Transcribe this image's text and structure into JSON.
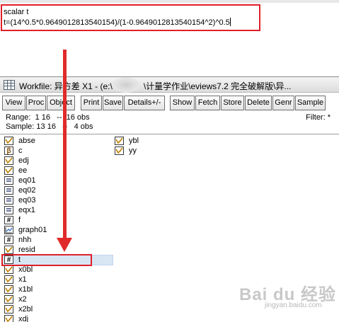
{
  "command": {
    "line1": "scalar t",
    "line2": "t=(14^0.5*0.9649012813540154)/(1-0.9649012813540154^2)^0.5"
  },
  "workfile": {
    "title": "Workfile: 异方差 X1 - (e:\\",
    "title_path": "\\计量学作业\\eviews7.2 完全破解版\\异...",
    "window_buttons": [
      "-",
      "□",
      "×"
    ],
    "toolbar": [
      "View",
      "Proc",
      "Object",
      "Print",
      "Save",
      "Details+/-",
      "Show",
      "Fetch",
      "Store",
      "Delete",
      "Genr",
      "Sample"
    ],
    "range_line": "Range:  1 16   --  16 obs",
    "sample_line": "Sample: 13 16   --   4 obs",
    "filter": "Filter: *"
  },
  "objects_col1": [
    {
      "name": "abse",
      "icon": "series-icon"
    },
    {
      "name": "c",
      "icon": "coef-icon"
    },
    {
      "name": "edj",
      "icon": "series-icon"
    },
    {
      "name": "ee",
      "icon": "series-icon"
    },
    {
      "name": "eq01",
      "icon": "equation-icon"
    },
    {
      "name": "eq02",
      "icon": "equation-icon"
    },
    {
      "name": "eq03",
      "icon": "equation-icon"
    },
    {
      "name": "eqx1",
      "icon": "equation-icon"
    },
    {
      "name": "f",
      "icon": "scalar-icon"
    },
    {
      "name": "graph01",
      "icon": "graph-icon"
    },
    {
      "name": "nhh",
      "icon": "scalar-icon"
    },
    {
      "name": "resid",
      "icon": "series-icon"
    },
    {
      "name": "t",
      "icon": "scalar-icon"
    },
    {
      "name": "x0bl",
      "icon": "series-icon"
    },
    {
      "name": "x1",
      "icon": "series-icon"
    },
    {
      "name": "x1bl",
      "icon": "series-icon"
    },
    {
      "name": "x2",
      "icon": "series-icon"
    },
    {
      "name": "x2bl",
      "icon": "series-icon"
    },
    {
      "name": "xdj",
      "icon": "series-icon"
    }
  ],
  "objects_col2": [
    {
      "name": "ybl",
      "icon": "series-icon"
    },
    {
      "name": "yy",
      "icon": "series-icon"
    }
  ],
  "watermark": {
    "big": "Bai du 经验",
    "small": "jingyan.baidu.com"
  },
  "colors": {
    "annotation": "#e0202a",
    "selection": "#d8e6f4"
  }
}
